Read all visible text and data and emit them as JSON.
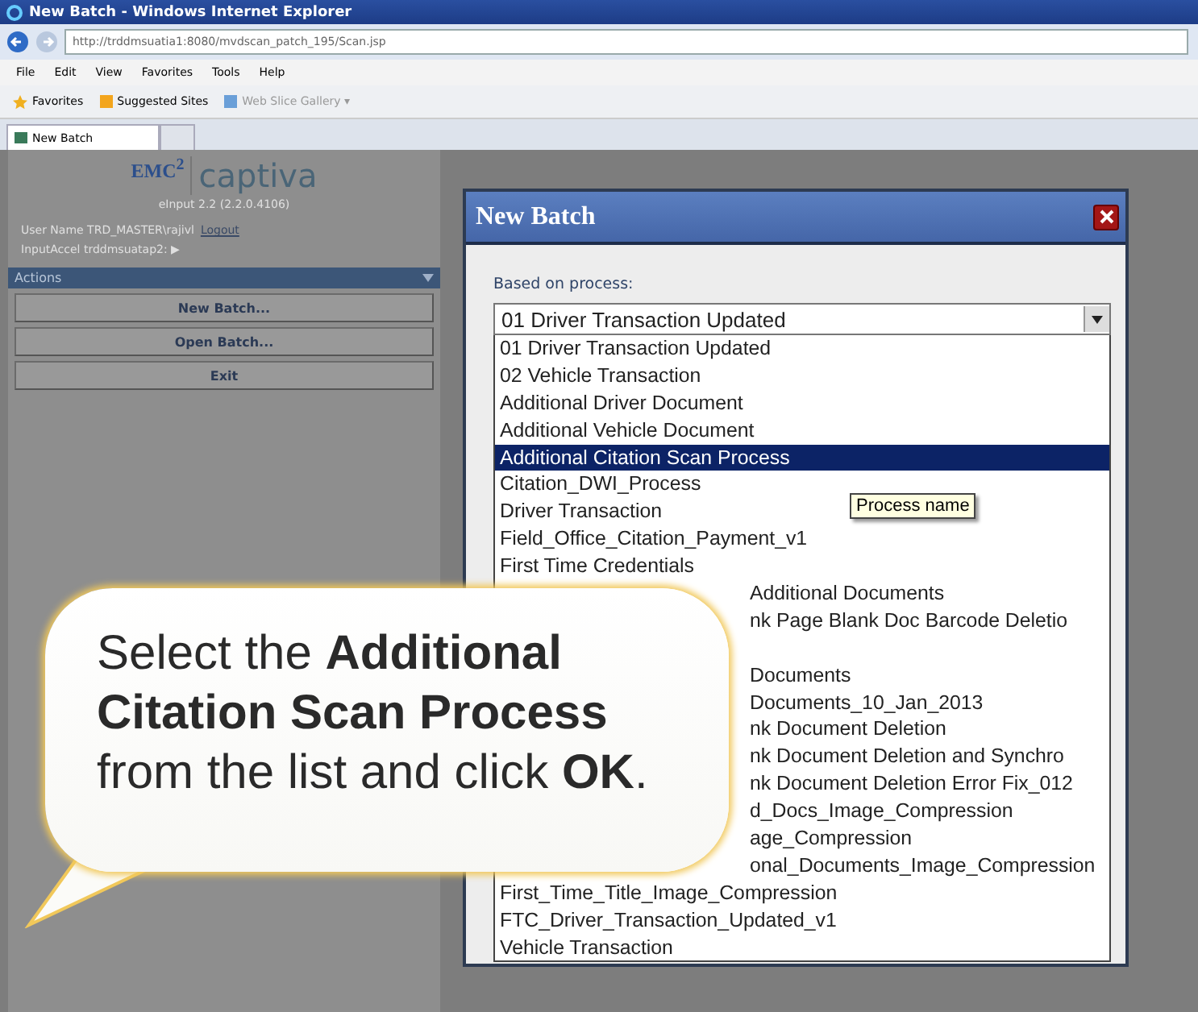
{
  "browser": {
    "title": "New Batch - Windows Internet Explorer",
    "address": "http://trddmsuatia1:8080/mvdscan_patch_195/Scan.jsp",
    "menu": [
      "File",
      "Edit",
      "View",
      "Favorites",
      "Tools",
      "Help"
    ],
    "favorites": "Favorites",
    "links": [
      "Suggested Sites",
      "Web Slice Gallery ▾"
    ],
    "tabs": [
      {
        "label": "New Batch",
        "selected": true
      }
    ]
  },
  "sidebar": {
    "logo": "EMC$^{2}$",
    "product": "captiva",
    "version": "eInput 2.2 (2.2.0.4106)",
    "user_label": "User Name TRD_MASTER\\rajivl",
    "logout": "Logout",
    "server": "InputAccel trddmsuatap2: ▶",
    "actions_title": "Actions",
    "buttons": [
      "New Batch...",
      "Open Batch...",
      "Exit"
    ]
  },
  "dialog": {
    "title": "New Batch",
    "field_label": "Based on process:",
    "select_value": "01 Driver Transaction Updated",
    "tooltip": "Process name",
    "options": [
      {
        "kind": "full",
        "label": "01 Driver Transaction Updated",
        "selected": false
      },
      {
        "kind": "full",
        "label": "02 Vehicle Transaction",
        "selected": false
      },
      {
        "kind": "full",
        "label": "Additional Driver Document",
        "selected": false
      },
      {
        "kind": "full",
        "label": "Additional Vehicle Document",
        "selected": false
      },
      {
        "kind": "full",
        "label": "Additional  Citation  Scan  Process",
        "selected": true
      },
      {
        "kind": "full",
        "label": "Citation_DWI_Process",
        "selected": false
      },
      {
        "kind": "full",
        "label": "Driver Transaction",
        "selected": false
      },
      {
        "kind": "full",
        "label": "Field_Office_Citation_Payment_v1",
        "selected": false
      },
      {
        "kind": "full",
        "label": "First Time Credentials",
        "selected": false
      },
      {
        "kind": "covered",
        "label": "Additional Documents",
        "selected": false
      },
      {
        "kind": "covered",
        "label": "nk Page Blank Doc Barcode Deletio",
        "selected": false
      },
      {
        "kind": "hidden"
      },
      {
        "kind": "covered",
        "label": "Documents",
        "selected": false
      },
      {
        "kind": "covered",
        "label": "Documents_10_Jan_2013",
        "selected": false
      },
      {
        "kind": "covered",
        "label": "nk Document Deletion",
        "selected": false
      },
      {
        "kind": "covered",
        "label": "nk Document Deletion and Synchro",
        "selected": false
      },
      {
        "kind": "covered",
        "label": "nk Document Deletion Error Fix_012",
        "selected": false
      },
      {
        "kind": "covered",
        "label": "d_Docs_Image_Compression",
        "selected": false
      },
      {
        "kind": "covered",
        "label": "age_Compression",
        "selected": false
      },
      {
        "kind": "covered",
        "label": "onal_Documents_Image_Compression",
        "selected": false
      },
      {
        "kind": "full",
        "label": "First_Time_Title_Image_Compression",
        "selected": false
      },
      {
        "kind": "full",
        "label": "FTC_Driver_Transaction_Updated_v1",
        "selected": false
      },
      {
        "kind": "full",
        "label": "Vehicle Transaction",
        "selected": false
      }
    ]
  },
  "callout": {
    "text": "Select the **Additional Citation Scan Process** from the list and click **OK**."
  }
}
